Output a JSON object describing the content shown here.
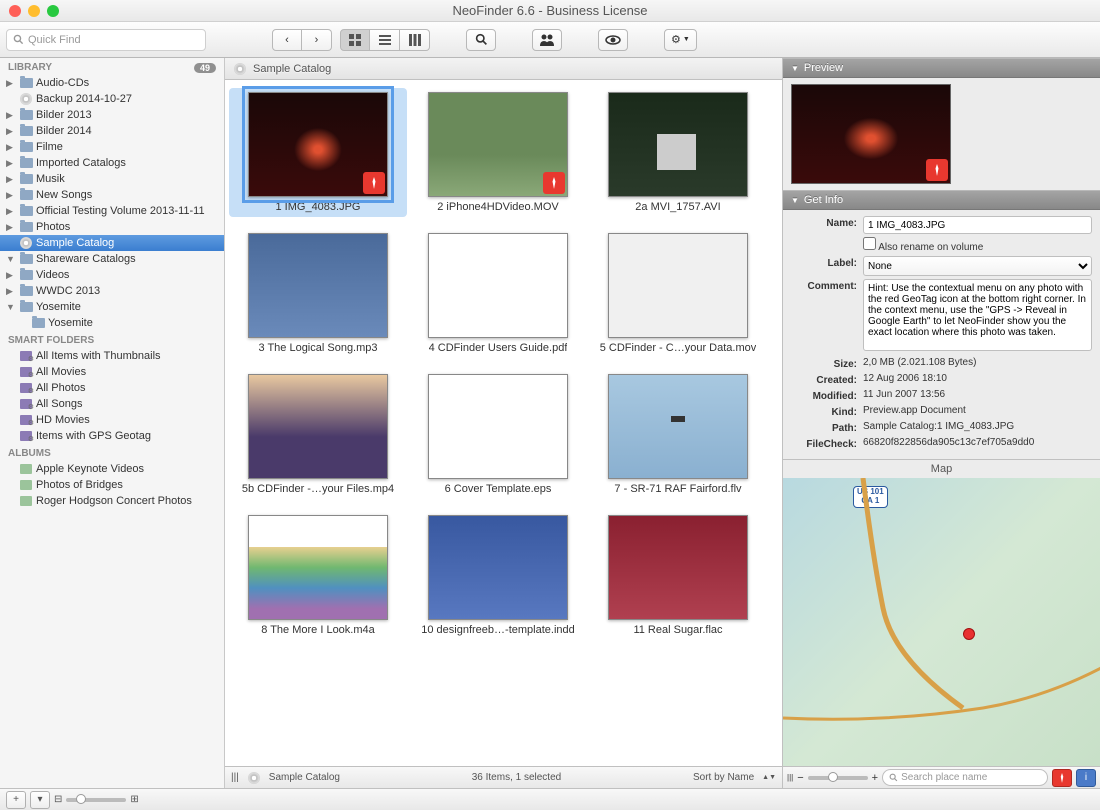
{
  "window": {
    "title": "NeoFinder 6.6 - Business License"
  },
  "search": {
    "placeholder": "Quick Find"
  },
  "sidebar": {
    "library_header": "LIBRARY",
    "library_badge": "49",
    "library": [
      {
        "label": "Audio-CDs",
        "arrow": "▶",
        "icon": "folder"
      },
      {
        "label": "Backup 2014-10-27",
        "arrow": "",
        "icon": "disc"
      },
      {
        "label": "Bilder 2013",
        "arrow": "▶",
        "icon": "folder"
      },
      {
        "label": "Bilder 2014",
        "arrow": "▶",
        "icon": "folder"
      },
      {
        "label": "Filme",
        "arrow": "▶",
        "icon": "folder"
      },
      {
        "label": "Imported Catalogs",
        "arrow": "▶",
        "icon": "folder"
      },
      {
        "label": "Musik",
        "arrow": "▶",
        "icon": "folder"
      },
      {
        "label": "New Songs",
        "arrow": "▶",
        "icon": "folder"
      },
      {
        "label": "Official Testing Volume 2013-11-11",
        "arrow": "▶",
        "icon": "folder"
      },
      {
        "label": "Photos",
        "arrow": "▶",
        "icon": "folder"
      },
      {
        "label": "Sample Catalog",
        "arrow": "",
        "icon": "disc",
        "selected": true
      },
      {
        "label": "Shareware Catalogs",
        "arrow": "▼",
        "icon": "folder"
      },
      {
        "label": "Videos",
        "arrow": "▶",
        "icon": "folder"
      },
      {
        "label": "WWDC 2013",
        "arrow": "▶",
        "icon": "folder"
      },
      {
        "label": "Yosemite",
        "arrow": "▼",
        "icon": "folder"
      },
      {
        "label": "Yosemite",
        "arrow": "",
        "icon": "folder",
        "indent": true
      }
    ],
    "smart_header": "SMART FOLDERS",
    "smart": [
      {
        "label": "All Items with Thumbnails"
      },
      {
        "label": "All Movies"
      },
      {
        "label": "All Photos"
      },
      {
        "label": "All Songs"
      },
      {
        "label": "HD Movies"
      },
      {
        "label": "Items with GPS Geotag"
      }
    ],
    "albums_header": "ALBUMS",
    "albums": [
      {
        "label": "Apple Keynote Videos"
      },
      {
        "label": "Photos of Bridges"
      },
      {
        "label": "Roger Hodgson Concert Photos"
      }
    ]
  },
  "pathbar": {
    "text": "Sample Catalog"
  },
  "items": [
    {
      "name": "1 IMG_4083.JPG",
      "tv": "tv1",
      "pin": true,
      "selected": true
    },
    {
      "name": "2 iPhone4HDVideo.MOV",
      "tv": "tv2",
      "pin": true
    },
    {
      "name": "2a MVI_1757.AVI",
      "tv": "tv3"
    },
    {
      "name": "3 The Logical Song.mp3",
      "tv": "tv4"
    },
    {
      "name": "4 CDFinder Users Guide.pdf",
      "tv": "tv5"
    },
    {
      "name": "5 CDFinder - C…your Data.mov",
      "tv": "tv6"
    },
    {
      "name": "5b CDFinder -…your Files.mp4",
      "tv": "tv7"
    },
    {
      "name": "6 Cover Template.eps",
      "tv": "tv8"
    },
    {
      "name": "7 - SR-71 RAF Fairford.flv",
      "tv": "tv9"
    },
    {
      "name": "8 The More I Look.m4a",
      "tv": "tv10"
    },
    {
      "name": "10 designfreeb…-template.indd",
      "tv": "tv11"
    },
    {
      "name": "11 Real Sugar.flac",
      "tv": "tv12"
    }
  ],
  "inspector": {
    "preview_header": "Preview",
    "getinfo_header": "Get Info",
    "name_label": "Name:",
    "name_value": "1 IMG_4083.JPG",
    "rename_check": "Also rename on volume",
    "label_label": "Label:",
    "label_value": "None",
    "comment_label": "Comment:",
    "comment_value": "Hint: Use the contextual menu on any photo with the red GeoTag icon at the bottom right corner. In the context menu, use the \"GPS -> Reveal in Google Earth\" to let NeoFinder show you the exact location where this photo was taken.",
    "size_label": "Size:",
    "size_value": "2,0 MB (2.021.108 Bytes)",
    "created_label": "Created:",
    "created_value": "12 Aug 2006 18:10",
    "modified_label": "Modified:",
    "modified_value": "11 Jun 2007 13:56",
    "kind_label": "Kind:",
    "kind_value": "Preview.app Document",
    "path_label": "Path:",
    "path_value": "Sample Catalog:1 IMG_4083.JPG",
    "filecheck_label": "FileCheck:",
    "filecheck_value": "66820f822856da905c13c7ef705a9dd0"
  },
  "map": {
    "header": "Map",
    "shield1": "US 101",
    "shield2": "CA 1",
    "search_placeholder": "Search place name"
  },
  "status": {
    "path": "Sample Catalog",
    "count": "36 Items, 1 selected",
    "sort": "Sort by Name"
  }
}
